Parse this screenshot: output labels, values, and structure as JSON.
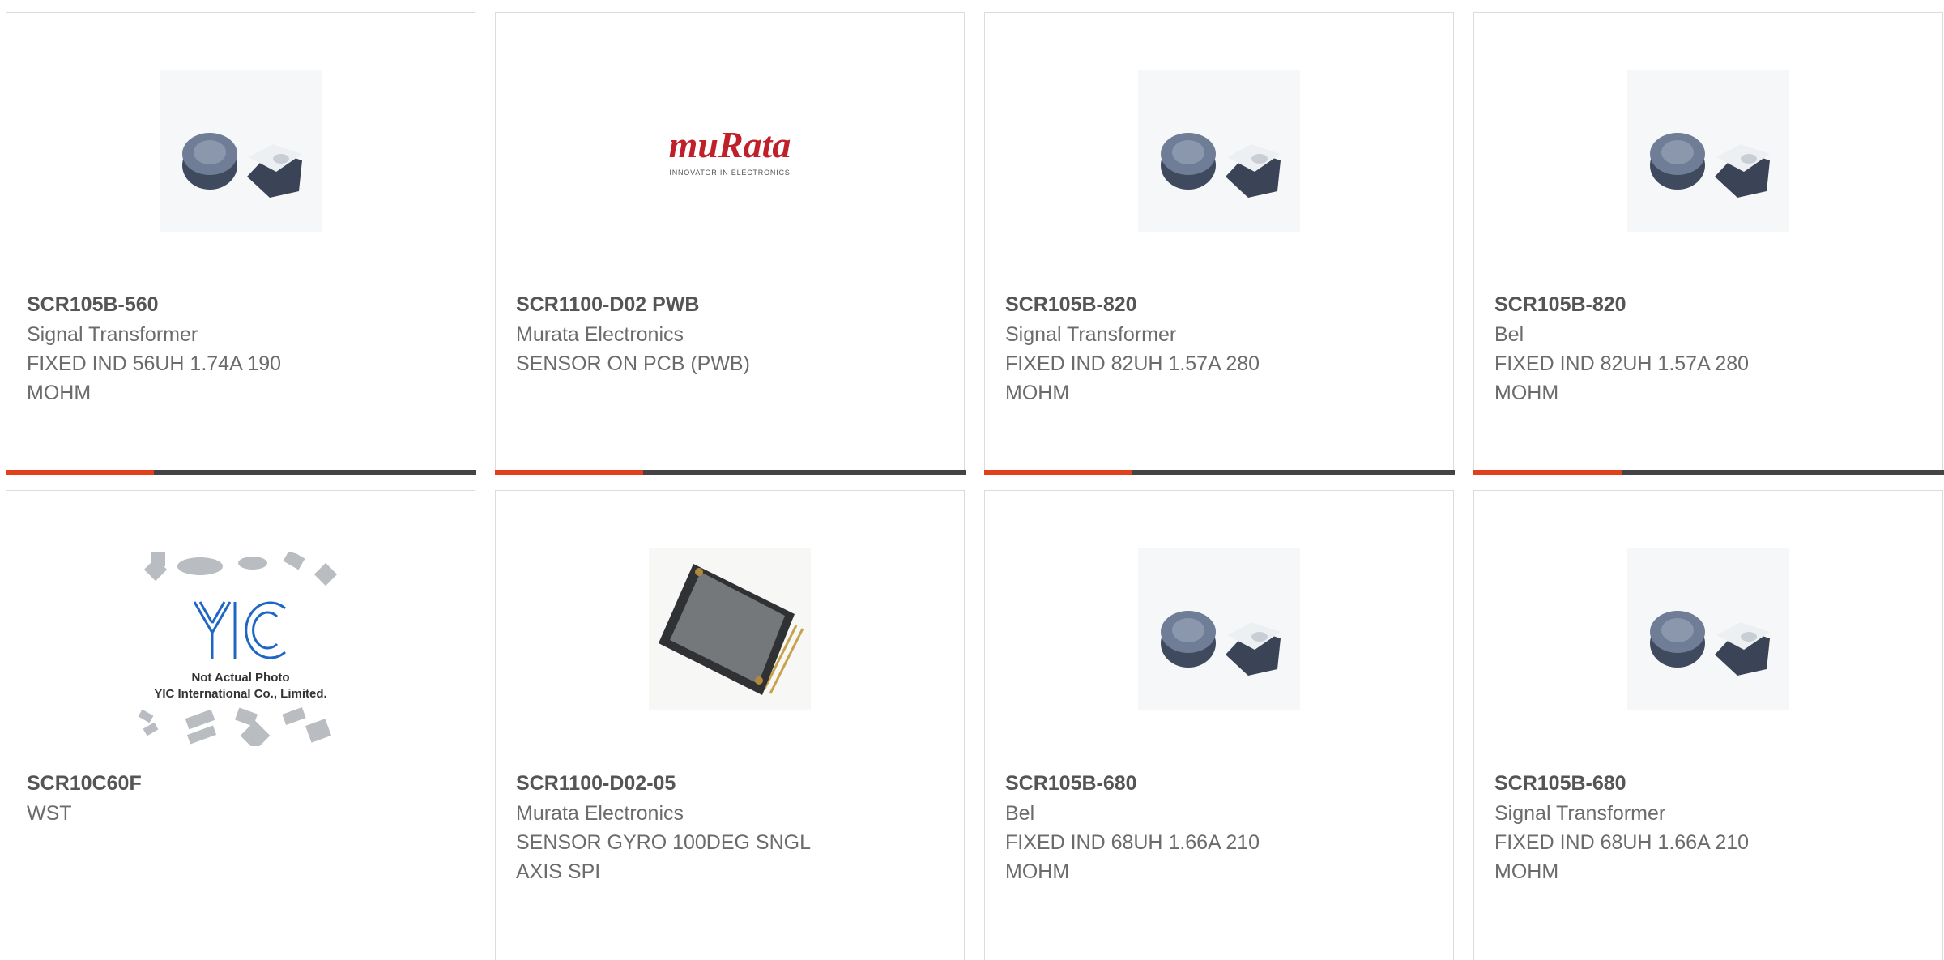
{
  "colors": {
    "accent": "#e0401a",
    "bar": "#444444",
    "border": "#dcdcdc"
  },
  "cards": [
    {
      "part_number": "SCR105B-560",
      "manufacturer": "Signal Transformer",
      "description_1": "FIXED IND 56UH 1.74A 190",
      "description_2": "MOHM",
      "image": "inductor-photo"
    },
    {
      "part_number": "SCR1100-D02 PWB",
      "manufacturer": "Murata Electronics",
      "description_1": "SENSOR ON PCB (PWB)",
      "description_2": "",
      "image": "murata-logo",
      "logo_text": "muRata",
      "logo_tagline": "INNOVATOR IN ELECTRONICS"
    },
    {
      "part_number": "SCR105B-820",
      "manufacturer": "Signal Transformer",
      "description_1": "FIXED IND 82UH 1.57A 280",
      "description_2": "MOHM",
      "image": "inductor-photo"
    },
    {
      "part_number": "SCR105B-820",
      "manufacturer": "Bel",
      "description_1": "FIXED IND 82UH 1.57A 280",
      "description_2": "MOHM",
      "image": "inductor-photo"
    },
    {
      "part_number": "SCR10C60F",
      "manufacturer": "WST",
      "description_1": "",
      "description_2": "",
      "image": "not-actual-photo",
      "placeholder_line_1": "Not Actual Photo",
      "placeholder_line_2": "YIC International Co., Limited.",
      "logo_text": "YIC"
    },
    {
      "part_number": "SCR1100-D02-05",
      "manufacturer": "Murata Electronics",
      "description_1": "SENSOR GYRO 100DEG SNGL",
      "description_2": "AXIS SPI",
      "image": "ic-chip-photo"
    },
    {
      "part_number": "SCR105B-680",
      "manufacturer": "Bel",
      "description_1": "FIXED IND 68UH 1.66A 210",
      "description_2": "MOHM",
      "image": "inductor-photo"
    },
    {
      "part_number": "SCR105B-680",
      "manufacturer": "Signal Transformer",
      "description_1": "FIXED IND 68UH 1.66A 210",
      "description_2": "MOHM",
      "image": "inductor-photo"
    }
  ]
}
